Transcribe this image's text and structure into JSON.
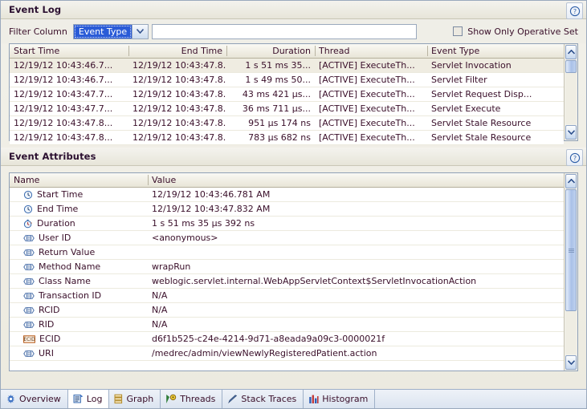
{
  "event_log": {
    "title": "Event Log",
    "help_icon": "help-circle-icon",
    "filter": {
      "label": "Filter Column",
      "selected_column": "Event Type",
      "dropdown_icon": "chevron-down-icon",
      "text_value": "",
      "text_placeholder": "",
      "operative_set_label": "Show Only Operative Set",
      "operative_set_checked": false
    },
    "columns": [
      "Start Time",
      "End Time",
      "Duration",
      "Thread",
      "Event Type"
    ],
    "rows": [
      {
        "start_time": "12/19/12 10:43:46.7...",
        "end_time": "12/19/12 10:43:47.8...",
        "duration": "1 s 51 ms 35...",
        "thread": "[ACTIVE] ExecuteTh...",
        "event_type": "Servlet Invocation",
        "selected": true
      },
      {
        "start_time": "12/19/12 10:43:46.7...",
        "end_time": "12/19/12 10:43:47.8...",
        "duration": "1 s 49 ms 50...",
        "thread": "[ACTIVE] ExecuteTh...",
        "event_type": "Servlet Filter",
        "selected": false
      },
      {
        "start_time": "12/19/12 10:43:47.7...",
        "end_time": "12/19/12 10:43:47.8...",
        "duration": "43 ms 421 µs...",
        "thread": "[ACTIVE] ExecuteTh...",
        "event_type": "Servlet Request Disp...",
        "selected": false
      },
      {
        "start_time": "12/19/12 10:43:47.7...",
        "end_time": "12/19/12 10:43:47.8...",
        "duration": "36 ms 711 µs...",
        "thread": "[ACTIVE] ExecuteTh...",
        "event_type": "Servlet Execute",
        "selected": false
      },
      {
        "start_time": "12/19/12 10:43:47.8...",
        "end_time": "12/19/12 10:43:47.8...",
        "duration": "951 µs 174 ns",
        "thread": "[ACTIVE] ExecuteTh...",
        "event_type": "Servlet Stale Resource",
        "selected": false
      },
      {
        "start_time": "12/19/12 10:43:47.8...",
        "end_time": "12/19/12 10:43:47.8...",
        "duration": "783 µs 682 ns",
        "thread": "[ACTIVE] ExecuteTh...",
        "event_type": "Servlet Stale Resource",
        "selected": false
      }
    ],
    "scrollbar": {
      "up_icon": "scroll-up-icon",
      "down_icon": "scroll-down-icon"
    }
  },
  "event_attributes": {
    "title": "Event Attributes",
    "help_icon": "help-circle-icon",
    "columns": [
      "Name",
      "Value"
    ],
    "rows": [
      {
        "icon": "clock-icon",
        "name": "Start Time",
        "value": "12/19/12 10:43:46.781 AM"
      },
      {
        "icon": "clock-icon",
        "name": "End Time",
        "value": "12/19/12 10:43:47.832 AM"
      },
      {
        "icon": "stopwatch-icon",
        "name": "Duration",
        "value": "1 s 51 ms 35 µs 392 ns"
      },
      {
        "icon": "attribute-icon",
        "name": "User ID",
        "value": "<anonymous>"
      },
      {
        "icon": "attribute-icon",
        "name": "Return Value",
        "value": ""
      },
      {
        "icon": "attribute-icon",
        "name": "Method Name",
        "value": "wrapRun"
      },
      {
        "icon": "attribute-icon",
        "name": "Class Name",
        "value": "weblogic.servlet.internal.WebAppServletContext$ServletInvocationAction"
      },
      {
        "icon": "attribute-icon",
        "name": "Transaction ID",
        "value": "N/A"
      },
      {
        "icon": "attribute-icon",
        "name": "RCID",
        "value": "N/A"
      },
      {
        "icon": "attribute-icon",
        "name": "RID",
        "value": "N/A"
      },
      {
        "icon": "ecid-icon",
        "name": "ECID",
        "value": "d6f1b525-c24e-4214-9d71-a8eada9a09c3-0000021f"
      },
      {
        "icon": "attribute-icon",
        "name": "URI",
        "value": "/medrec/admin/viewNewlyRegisteredPatient.action"
      }
    ],
    "scrollbar": {
      "up_icon": "scroll-up-icon",
      "down_icon": "scroll-down-icon"
    }
  },
  "tabs": [
    {
      "label": "Overview",
      "icon": "overview-gear-icon",
      "active": false
    },
    {
      "label": "Log",
      "icon": "log-icon",
      "active": true
    },
    {
      "label": "Graph",
      "icon": "graph-icon",
      "active": false
    },
    {
      "label": "Threads",
      "icon": "threads-icon",
      "active": false
    },
    {
      "label": "Stack Traces",
      "icon": "stack-traces-icon",
      "active": false
    },
    {
      "label": "Histogram",
      "icon": "histogram-icon",
      "active": false
    }
  ],
  "colors": {
    "accent_blue": "#2a5bd7",
    "panel_bg": "#efeee7",
    "header_grad_top": "#f4f3ee",
    "header_grad_bottom": "#e7e5d9",
    "table_border": "#8fa0b6",
    "text": "#3a0f2a",
    "selected_row": "#efece1"
  }
}
